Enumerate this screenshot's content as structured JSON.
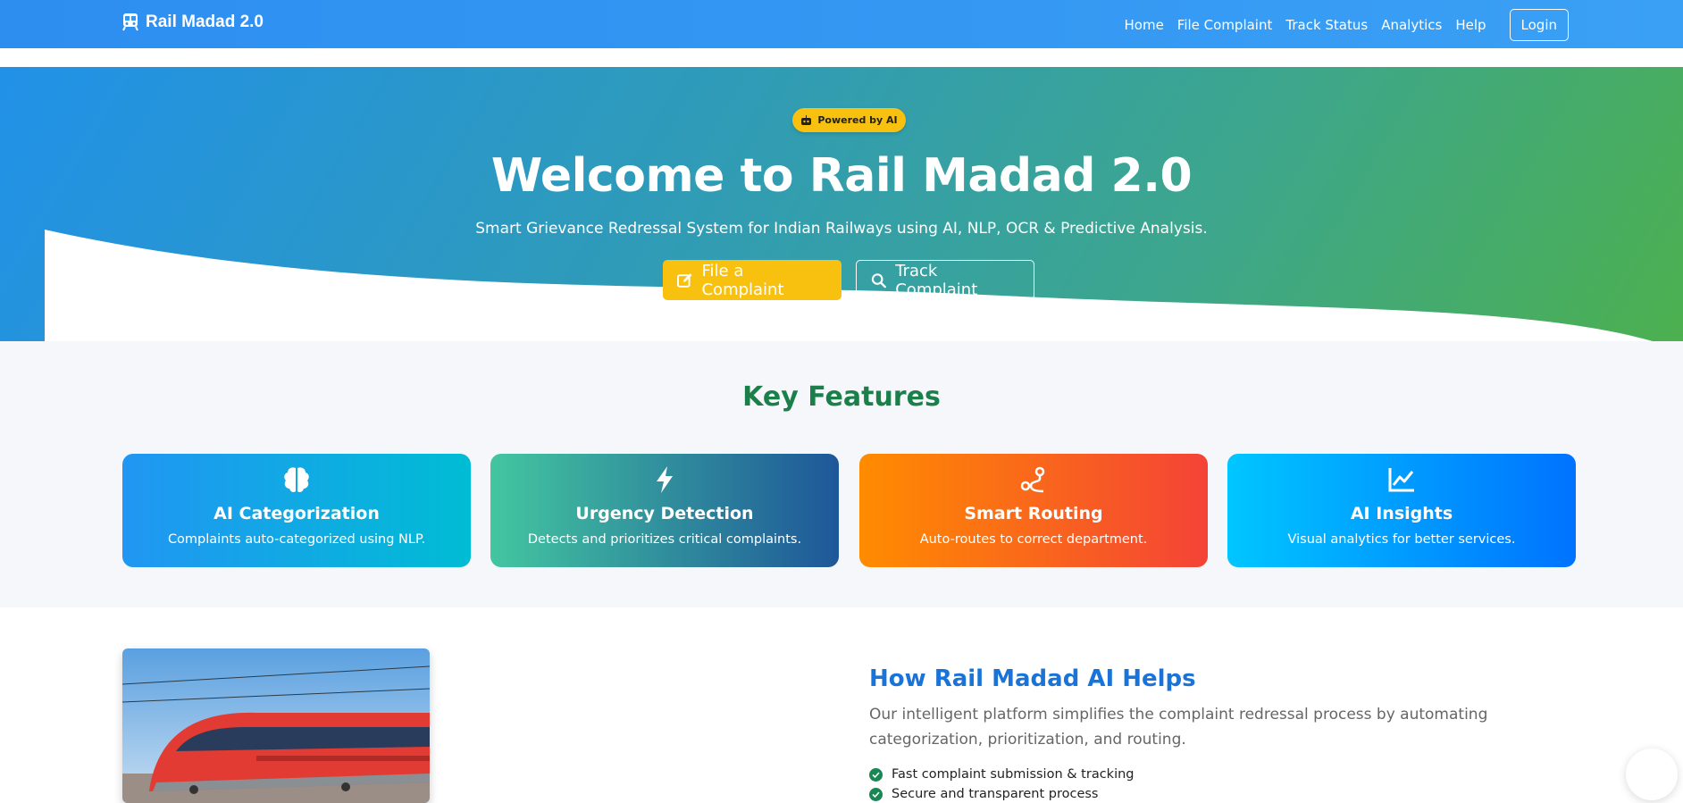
{
  "navbar": {
    "brand": "Rail Madad 2.0",
    "links": [
      "Home",
      "File Complaint",
      "Track Status",
      "Analytics",
      "Help"
    ],
    "login": "Login"
  },
  "hero": {
    "badge": "Powered by AI",
    "title": "Welcome to Rail Madad 2.0",
    "subtitle": "Smart Grievance Redressal System for Indian Railways using AI, NLP, OCR & Predictive Analysis.",
    "file_button": "File a Complaint",
    "track_button": "Track Complaint"
  },
  "features": {
    "title": "Key Features",
    "cards": [
      {
        "title": "AI Categorization",
        "desc": "Complaints auto-categorized using NLP.",
        "icon": "brain-icon"
      },
      {
        "title": "Urgency Detection",
        "desc": "Detects and prioritizes critical complaints.",
        "icon": "bolt-icon"
      },
      {
        "title": "Smart Routing",
        "desc": "Auto-routes to correct department.",
        "icon": "route-icon"
      },
      {
        "title": "AI Insights",
        "desc": "Visual analytics for better services.",
        "icon": "chart-line-icon"
      }
    ]
  },
  "how": {
    "title": "How Rail Madad AI Helps",
    "desc": "Our intelligent platform simplifies the complaint redressal process by automating categorization, prioritization, and routing.",
    "items": [
      "Fast complaint submission & tracking",
      "Secure and transparent process"
    ]
  },
  "colors": {
    "nav": "#2d8ef0",
    "accent_yellow": "#f8c10f",
    "features_title": "#1b7f4a",
    "how_title": "#1a73d9"
  }
}
